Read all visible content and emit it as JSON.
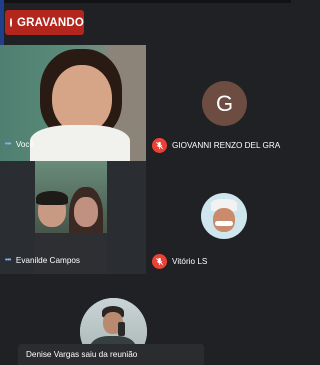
{
  "recording": {
    "label": "GRAVANDO"
  },
  "participants": [
    {
      "name": "Você",
      "speaking": true,
      "muted": false
    },
    {
      "name": "GIOVANNI RENZO DEL GRA",
      "initial": "G",
      "avatar_color": "#6d4c41",
      "muted": true
    },
    {
      "name": "Evanilde Campos",
      "speaking": true,
      "muted": false
    },
    {
      "name": "Vitório LS",
      "muted": true
    }
  ],
  "toast": {
    "message": "Denise Vargas saiu da reunião"
  },
  "colors": {
    "recording_badge": "#b3261e",
    "muted_icon": "#ea4335",
    "background": "#202124",
    "speaking_dots": "#8ab4f8"
  },
  "icons": {
    "muted": "mic-off-icon",
    "speaking": "audio-dots-icon",
    "recording": "record-dot-icon"
  }
}
